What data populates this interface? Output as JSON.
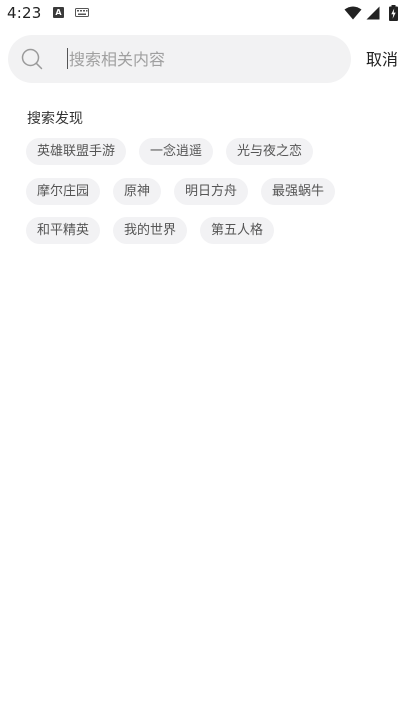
{
  "status_bar": {
    "time": "4:23",
    "font_badge": "A"
  },
  "search": {
    "placeholder": "搜索相关内容",
    "cancel_label": "取消"
  },
  "discover": {
    "title": "搜索发现",
    "rows": [
      [
        "英雄联盟手游",
        "一念逍遥",
        "光与夜之恋"
      ],
      [
        "摩尔庄园",
        "原神",
        "明日方舟",
        "最强蜗牛"
      ],
      [
        "和平精英",
        "我的世界",
        "第五人格"
      ]
    ]
  }
}
